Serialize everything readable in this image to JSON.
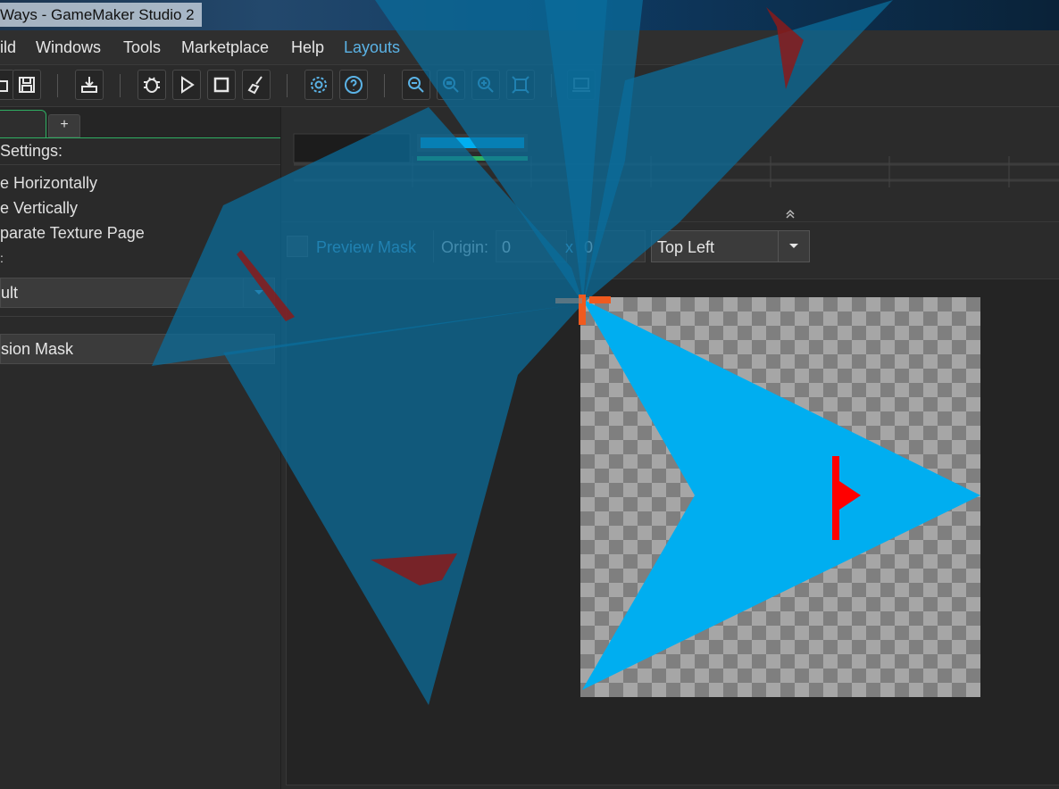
{
  "window": {
    "title": "Ways - GameMaker Studio 2"
  },
  "menu": {
    "items": [
      "ild",
      "Windows",
      "Tools",
      "Marketplace",
      "Help"
    ],
    "layouts": "Layouts"
  },
  "toolbar": {
    "icons": [
      "open-icon",
      "save-icon",
      "create-executable-icon",
      "debug-icon",
      "run-icon",
      "stop-icon",
      "clean-icon",
      "preferences-icon",
      "help-icon",
      "zoom-out-icon",
      "zoom-reset-icon",
      "zoom-in-icon",
      "fit-icon",
      "device-icon"
    ]
  },
  "left_panel": {
    "tab_add": "+",
    "settings_header": "Settings:",
    "tile_h": "e Horizontally",
    "tile_v": "e Vertically",
    "separate_page": "parate Texture Page",
    "colon_label": ":",
    "group_dropdown": "ult",
    "collision_button": "sion Mask"
  },
  "editor": {
    "collapse_icon": "collapse-up-icon",
    "preview_mask_label": "Preview Mask",
    "origin_label": "Origin:",
    "origin_x": "0",
    "origin_sep": "x",
    "origin_y": "0",
    "origin_preset": "Top Left"
  },
  "colors": {
    "accent": "#5bb3e6",
    "sprite_fill": "#00aef0",
    "sprite_mark": "#ff0000",
    "overlay_fill": "#0a6e9c",
    "tab_highlight": "#2fb063"
  }
}
